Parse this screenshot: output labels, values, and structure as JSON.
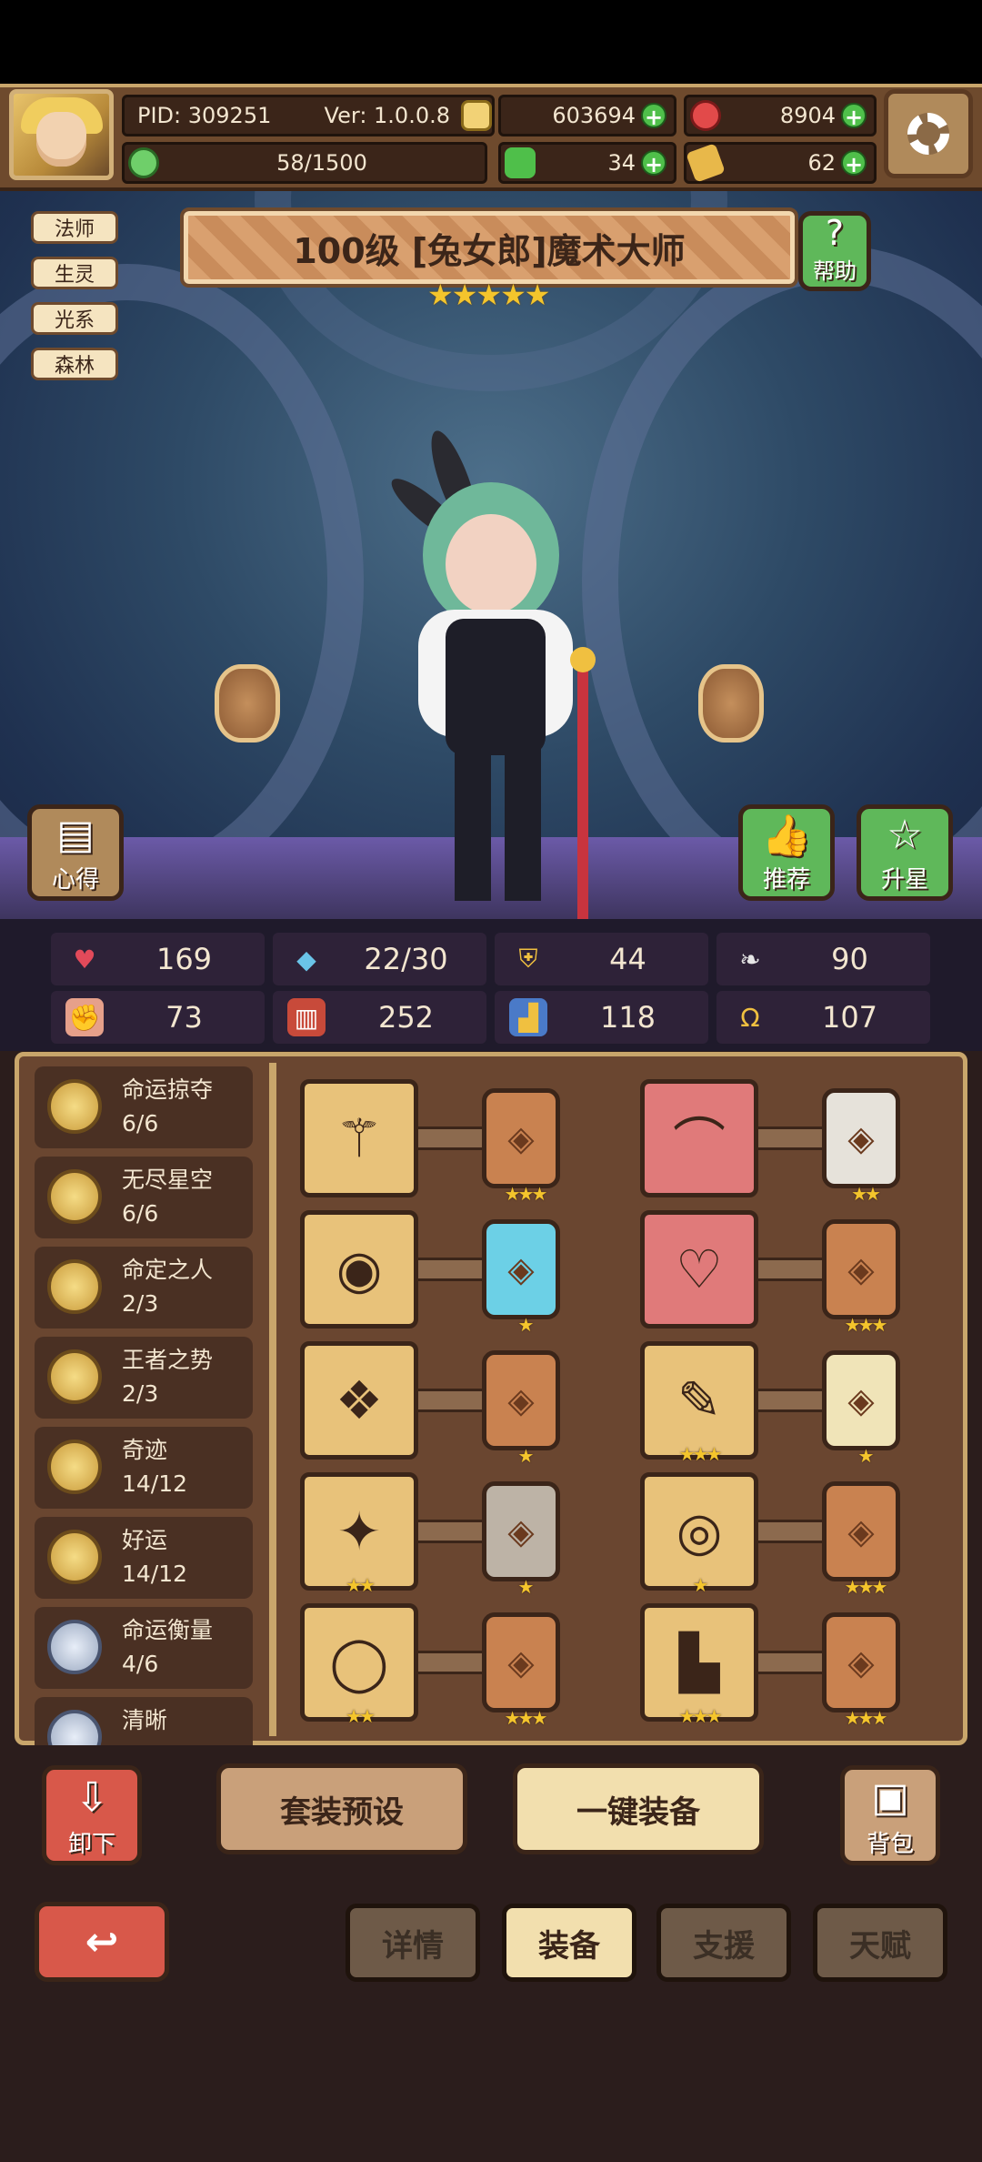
{
  "header": {
    "pid": "PID: 309251",
    "version": "Ver: 1.0.0.8",
    "gold": "603694",
    "gems": "8904",
    "exp": "58/1500",
    "clover": "34",
    "ticket": "62"
  },
  "tags": [
    "法师",
    "生灵",
    "光系",
    "森林"
  ],
  "hero": {
    "title": "100级  [兔女郎]魔术大师",
    "stars": "★★★★★",
    "help_label": "帮助"
  },
  "side_buttons": {
    "insight": "心得",
    "recommend": "推荐",
    "star_up": "升星"
  },
  "stats": [
    {
      "icon": "heart-icon",
      "value": "169"
    },
    {
      "icon": "water-drop-icon",
      "value": "22/30"
    },
    {
      "icon": "shield-icon",
      "value": "44"
    },
    {
      "icon": "wing-icon",
      "value": "90"
    },
    {
      "icon": "fist-icon",
      "value": "73"
    },
    {
      "icon": "book-icon",
      "value": "252"
    },
    {
      "icon": "boot-icon",
      "value": "118"
    },
    {
      "icon": "horseshoe-icon",
      "value": "107"
    }
  ],
  "sets": [
    {
      "name": "命运掠夺",
      "count": "6/6"
    },
    {
      "name": "无尽星空",
      "count": "6/6"
    },
    {
      "name": "命定之人",
      "count": "2/3"
    },
    {
      "name": "王者之势",
      "count": "2/3"
    },
    {
      "name": "奇迹",
      "count": "14/12"
    },
    {
      "name": "好运",
      "count": "14/12"
    },
    {
      "name": "命运衡量",
      "count": "4/6"
    },
    {
      "name": "清晰",
      "count": ""
    }
  ],
  "equip": [
    {
      "item": "staff-icon",
      "item_stars": "",
      "card": "★★★",
      "card_color": "#c98250"
    },
    {
      "item": "hat-icon",
      "item_stars": "",
      "card": "★★",
      "card_color": "#e6e2da"
    },
    {
      "item": "orb-icon",
      "item_stars": "",
      "card": "★",
      "card_color": "#6cd0e6"
    },
    {
      "item": "heart-armor-icon",
      "item_stars": "",
      "card": "★★★",
      "card_color": "#c98250"
    },
    {
      "item": "amulet-icon",
      "item_stars": "",
      "card": "★",
      "card_color": "#c98250"
    },
    {
      "item": "scroll-icon",
      "item_stars": "★★★",
      "card": "★",
      "card_color": "#f0e4b8"
    },
    {
      "item": "chest-icon",
      "item_stars": "★★",
      "card": "★",
      "card_color": "#bdb3a6"
    },
    {
      "item": "belt-icon",
      "item_stars": "★",
      "card": "★★★",
      "card_color": "#c98250"
    },
    {
      "item": "ring-icon",
      "item_stars": "★★",
      "card": "★★★",
      "card_color": "#c98250"
    },
    {
      "item": "boots-icon",
      "item_stars": "★★★",
      "card": "★★★",
      "card_color": "#c98250"
    }
  ],
  "actions": {
    "unequip": "卸下",
    "set_preset": "套装预设",
    "auto_equip": "一键装备",
    "bag": "背包"
  },
  "tabs": {
    "details": "详情",
    "equip": "装备",
    "support": "支援",
    "talent": "天赋"
  }
}
